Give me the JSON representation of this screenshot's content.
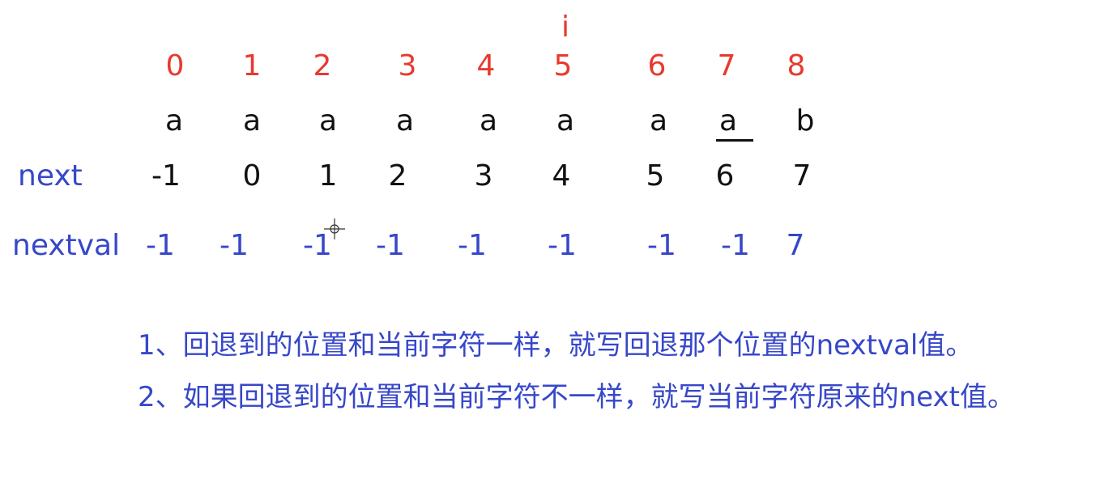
{
  "pointer": "i",
  "row_labels": {
    "next": "next",
    "nextval": "nextval"
  },
  "indices": [
    "0",
    "1",
    "2",
    "3",
    "4",
    "5",
    "6",
    "7",
    "8"
  ],
  "chars": [
    "a",
    "a",
    "a",
    "a",
    "a",
    "a",
    "a",
    "a",
    "b"
  ],
  "next": [
    "-1",
    "0",
    "1",
    "2",
    "3",
    "4",
    "5",
    "6",
    "7"
  ],
  "nextval": [
    "-1",
    "-1",
    "-1",
    "-1",
    "-1",
    "-1",
    "-1",
    "-1",
    "7"
  ],
  "notes": [
    "1、回退到的位置和当前字符一样，就写回退那个位置的nextval值。",
    "2、如果回退到的位置和当前字符不一样，就写当前字符原来的next值。"
  ],
  "colors": {
    "index": "#e8392f",
    "char": "#111111",
    "label": "#3747c9"
  }
}
